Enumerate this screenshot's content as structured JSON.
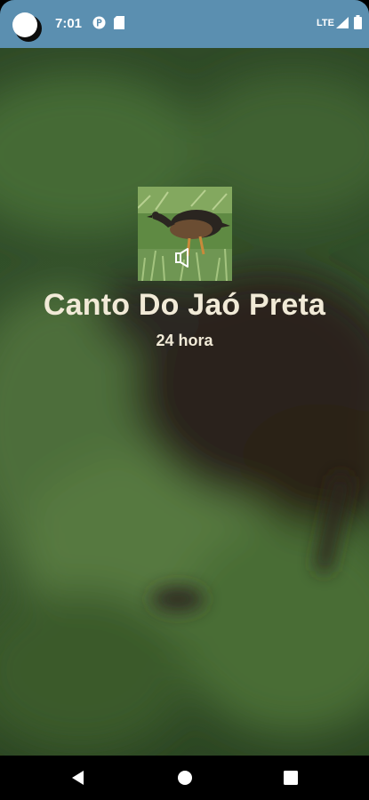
{
  "status_bar": {
    "time": "7:01",
    "network": "LTE",
    "icons": [
      "avatar-circle",
      "p-badge-icon",
      "sd-card-icon",
      "signal-icon",
      "battery-icon"
    ]
  },
  "main": {
    "thumbnail_icon": "bird-thumbnail",
    "speaker_icon": "speaker-icon",
    "title": "Canto Do Jaó Preta",
    "subtitle": "24 hora"
  },
  "nav_bar": {
    "icons": [
      "back-icon",
      "home-icon",
      "recents-icon"
    ]
  },
  "colors": {
    "status_bar_bg": "#5b8fb0",
    "title_text": "#f1ead7",
    "nav_bar_bg": "#000000"
  }
}
